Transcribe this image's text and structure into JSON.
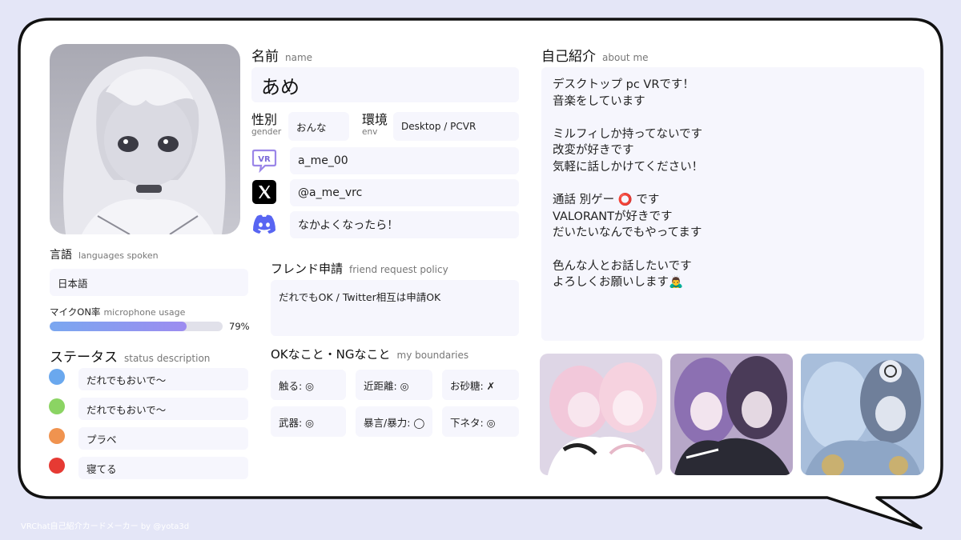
{
  "profile": {
    "name_label_jp": "名前",
    "name_label_en": "name",
    "name_value": "あめ",
    "gender_label_jp": "性別",
    "gender_label_en": "gender",
    "gender_value": "おんな",
    "env_label_jp": "環境",
    "env_label_en": "env",
    "env_value": "Desktop / PCVR"
  },
  "accounts": {
    "vrchat": "a_me_00",
    "vrchat_icon_text": "VR",
    "twitter": "@a_me_vrc",
    "discord": "なかよくなったら！"
  },
  "friend_request": {
    "label_jp": "フレンド申請",
    "label_en": "friend request policy",
    "value": "だれでもOK / Twitter相互は申請OK"
  },
  "boundaries": {
    "label_jp": "OKなこと・NGなこと",
    "label_en": "my boundaries",
    "items": [
      "触る: ◎",
      "近距離: ◎",
      "お砂糖: ✗",
      "武器: ◎",
      "暴言/暴力: ◯",
      "下ネタ: ◎"
    ]
  },
  "languages": {
    "label_jp": "言語",
    "label_en": "languages spoken",
    "value": "日本語"
  },
  "mic": {
    "label_jp": "マイクON率",
    "label_en": "microphone usage",
    "percent": 79,
    "percent_text": "79%"
  },
  "status": {
    "label_jp": "ステータス",
    "label_en": "status description",
    "items": [
      {
        "color": "#6aa8ee",
        "text": "だれでもおいで〜"
      },
      {
        "color": "#8bd463",
        "text": "だれでもおいで〜"
      },
      {
        "color": "#f0934f",
        "text": "プラベ"
      },
      {
        "color": "#e63a33",
        "text": "寝てる"
      }
    ]
  },
  "about": {
    "label_jp": "自己紹介",
    "label_en": "about me",
    "lines": [
      "デスクトップ pc VRです！",
      "音楽をしています",
      "",
      "ミルフィしか持ってないです",
      "改変が好きです",
      "気軽に話しかけてください！",
      "",
      "通話 別ゲー ⭕ です",
      "VALORANTが好きです",
      "だいたいなんでもやってます",
      "",
      "色んな人とお話したいです",
      "よろしくお願いします🙇‍♂️"
    ]
  },
  "footer": {
    "text": "VRChat自己紹介カードメーカー by @yota3d"
  },
  "colors": {
    "background": "#e4e6f7",
    "card": "#ffffff",
    "border": "#111111",
    "field": "#f6f6fd"
  }
}
